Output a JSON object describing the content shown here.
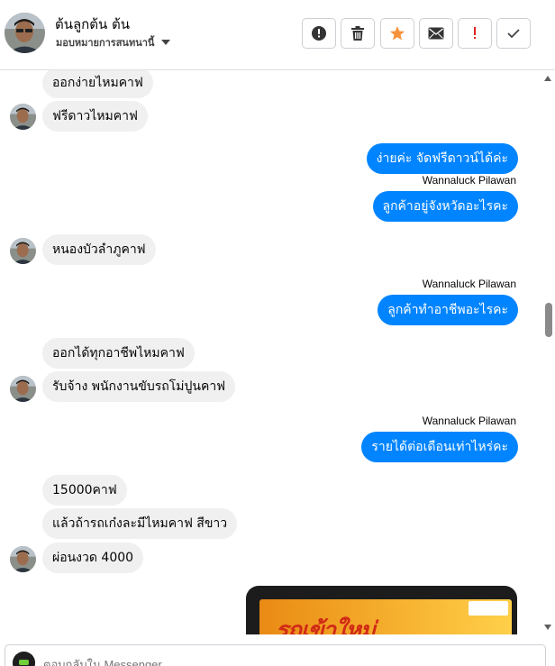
{
  "header": {
    "name": "ต้นลูกต้น ต้น",
    "assign_label": "มอบหมายการสนทนานี้",
    "actions": [
      {
        "icon": "report-icon",
        "label": ""
      },
      {
        "icon": "trash-icon",
        "label": ""
      },
      {
        "icon": "star-icon",
        "label": ""
      },
      {
        "icon": "mail-icon",
        "label": ""
      },
      {
        "icon": "important-icon",
        "label": ""
      },
      {
        "icon": "check-icon",
        "label": ""
      }
    ]
  },
  "messages": [
    {
      "dir": "in",
      "text": "ออกง่ายไหมคาฟ"
    },
    {
      "dir": "in",
      "text": "ฟรีดาวไหมคาฟ"
    },
    {
      "dir": "out",
      "text": "ง่ายค่ะ  จัดฟรีดาวน์ได้ค่ะ"
    },
    {
      "dir": "out",
      "sender": "Wannaluck Pilawan",
      "text": "ลูกค้าอยู่จังหวัดอะไรคะ"
    },
    {
      "dir": "in",
      "text": "หนองบัวลำภูคาฟ"
    },
    {
      "dir": "out",
      "sender": "Wannaluck Pilawan",
      "text": "ลูกค้าทำอาชีพอะไรคะ"
    },
    {
      "dir": "in",
      "text": "ออกได้ทุกอาชีพไหมคาฟ"
    },
    {
      "dir": "in",
      "text": "รับจ้าง พนักงานขับรถโม่ปูนคาฟ"
    },
    {
      "dir": "out",
      "sender": "Wannaluck Pilawan",
      "text": "รายได้ต่อเดือนเท่าไหร่คะ"
    },
    {
      "dir": "in",
      "text": "15000คาฟ"
    },
    {
      "dir": "in",
      "text": "แล้วถ้ารถเก๋งละมีไหมคาฟ สีขาว"
    },
    {
      "dir": "in",
      "text": "ผ่อนงวด 4000"
    }
  ],
  "attachment": {
    "headline": "รถเข้าใหม่"
  },
  "composer": {
    "placeholder": "ตอบกลับใน Messenger"
  },
  "colors": {
    "outgoing": "#0084ff",
    "incoming": "#f0f0f0",
    "star": "#f7923b",
    "important": "#e02020"
  }
}
